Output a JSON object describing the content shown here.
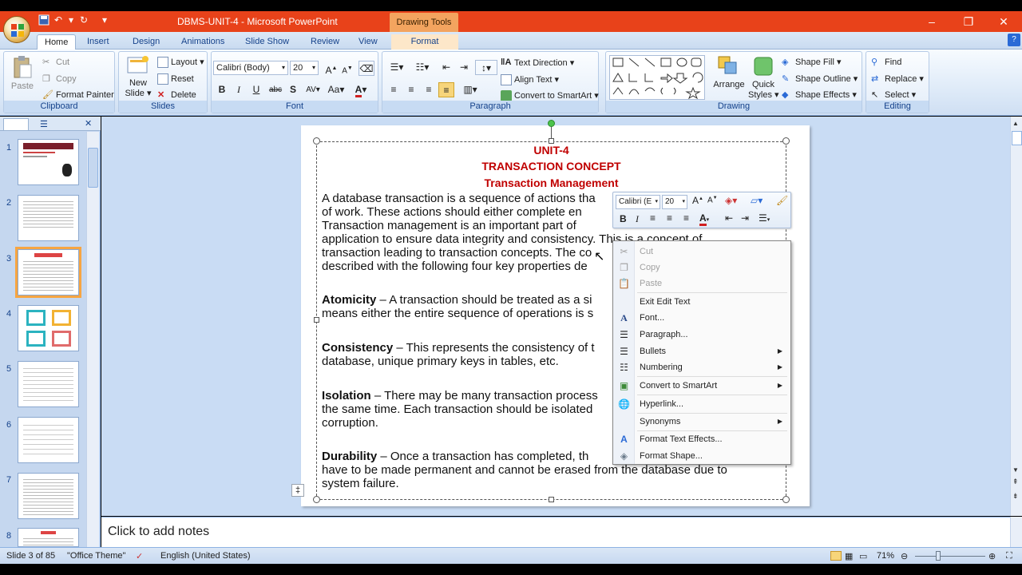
{
  "window": {
    "title": "DBMS-UNIT-4 - Microsoft PowerPoint",
    "contextual_tab": "Drawing Tools",
    "controls": [
      "–",
      "❐",
      "✕"
    ]
  },
  "tabs": [
    "Home",
    "Insert",
    "Design",
    "Animations",
    "Slide Show",
    "Review",
    "View",
    "Format"
  ],
  "ribbon": {
    "clipboard": {
      "label": "Clipboard",
      "paste": "Paste",
      "cut": "Cut",
      "copy": "Copy",
      "format_painter": "Format Painter"
    },
    "slides": {
      "label": "Slides",
      "new_slide": "New",
      "new_slide2": "Slide",
      "layout": "Layout",
      "reset": "Reset",
      "delete": "Delete"
    },
    "font": {
      "label": "Font",
      "font_name": "Calibri (Body)",
      "font_size": "20"
    },
    "paragraph": {
      "label": "Paragraph",
      "text_direction": "Text Direction",
      "align_text": "Align Text",
      "convert_smartart": "Convert to SmartArt"
    },
    "drawing": {
      "label": "Drawing",
      "arrange": "Arrange",
      "quick_styles": "Quick",
      "quick_styles2": "Styles",
      "shape_fill": "Shape Fill",
      "shape_outline": "Shape Outline",
      "shape_effects": "Shape Effects"
    },
    "editing": {
      "label": "Editing",
      "find": "Find",
      "replace": "Replace",
      "select": "Select"
    }
  },
  "thumbnails": [
    "1",
    "2",
    "3",
    "4",
    "5",
    "6",
    "7",
    "8"
  ],
  "slide": {
    "heading1": "UNIT-4",
    "heading2": "TRANSACTION CONCEPT",
    "heading3": "Transaction Management",
    "para1_lines": [
      "A database transaction is a sequence of actions tha",
      "of work. These actions should either complete en",
      "Transaction management is an important part of",
      "application to ensure data integrity and consistency. This is a concept of",
      "transaction leading to transaction concepts. The co",
      "described with the following four key properties de"
    ],
    "atomicity_term": "Atomicity",
    "atomicity_lines": [
      " – A transaction should be treated as a si",
      "means either the entire sequence of operations is s"
    ],
    "consistency_term": "Consistency",
    "consistency_lines": [
      " – This represents the consistency of t",
      "database, unique primary keys in tables, etc."
    ],
    "isolation_term": "Isolation",
    "isolation_lines": [
      " – There may be many transaction process",
      "the same time. Each transaction should be isolated",
      "corruption."
    ],
    "durability_term": "Durability",
    "durability_lines": [
      " – Once a transaction has completed, th",
      "have to be made permanent and cannot be erased from the database due to",
      "system failure."
    ]
  },
  "minibar": {
    "font": "Calibri (E",
    "size": "20"
  },
  "context_menu": [
    {
      "label": "Cut",
      "icon": "scissors-icon",
      "disabled": true
    },
    {
      "label": "Copy",
      "icon": "copy-icon",
      "disabled": true
    },
    {
      "label": "Paste",
      "icon": "paste-icon",
      "disabled": true
    },
    {
      "label": "Exit Edit Text",
      "icon": "",
      "disabled": false
    },
    {
      "label": "Font...",
      "icon": "font-icon",
      "disabled": false
    },
    {
      "label": "Paragraph...",
      "icon": "paragraph-icon",
      "disabled": false
    },
    {
      "label": "Bullets",
      "icon": "bullets-icon",
      "disabled": false,
      "submenu": true
    },
    {
      "label": "Numbering",
      "icon": "numbering-icon",
      "disabled": false,
      "submenu": true
    },
    {
      "label": "Convert to SmartArt",
      "icon": "smartart-icon",
      "disabled": false,
      "submenu": true
    },
    {
      "label": "Hyperlink...",
      "icon": "hyperlink-icon",
      "disabled": false
    },
    {
      "label": "Synonyms",
      "icon": "",
      "disabled": false,
      "submenu": true
    },
    {
      "label": "Format Text Effects...",
      "icon": "text-effects-icon",
      "disabled": false
    },
    {
      "label": "Format Shape...",
      "icon": "format-shape-icon",
      "disabled": false
    }
  ],
  "notes": {
    "placeholder": "Click to add notes"
  },
  "status": {
    "slide_info": "Slide 3 of 85",
    "theme": "\"Office Theme\"",
    "language": "English (United States)",
    "zoom": "71%"
  },
  "colors": {
    "title_bar": "#e8421a",
    "heading_red": "#c00000",
    "selection_orange": "#f7a541"
  }
}
